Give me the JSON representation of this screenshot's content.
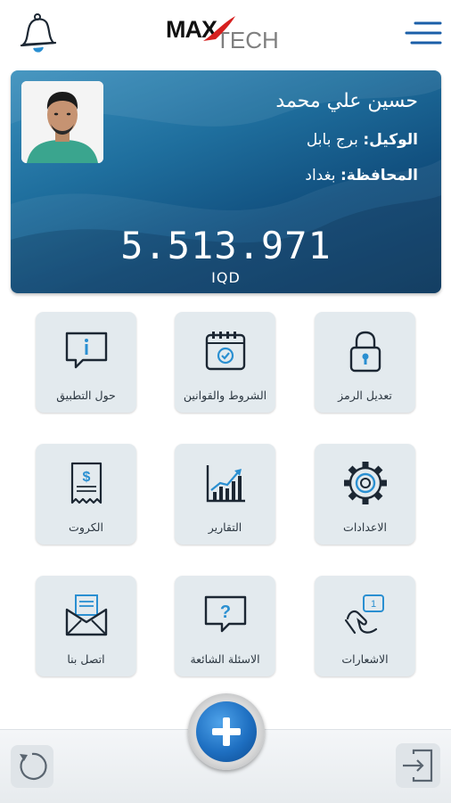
{
  "header": {
    "logo_max": "MAX",
    "logo_tech": "TECH",
    "icons": {
      "bell": "bell-icon",
      "menu": "hamburger-menu-icon"
    }
  },
  "profile": {
    "name": "حسين علي محمد",
    "agent_label": "الوكيل:",
    "agent_value": "برج بابل",
    "province_label": "المحافظة:",
    "province_value": "بغداد",
    "balance": "5.513.971",
    "currency": "IQD"
  },
  "tiles": [
    {
      "label": "تعديل الرمز",
      "icon": "lock-icon"
    },
    {
      "label": "الشروط والقوانين",
      "icon": "calendar-check-icon"
    },
    {
      "label": "حول التطبيق",
      "icon": "info-chat-icon"
    },
    {
      "label": "الاعدادات",
      "icon": "gear-icon"
    },
    {
      "label": "التقارير",
      "icon": "chart-icon"
    },
    {
      "label": "الكروت",
      "icon": "receipt-icon"
    },
    {
      "label": "الاشعارات",
      "icon": "notification-hand-icon"
    },
    {
      "label": "الاسئلة الشائعة",
      "icon": "question-chat-icon"
    },
    {
      "label": "اتصل بنا",
      "icon": "mail-icon"
    }
  ],
  "bottom": {
    "icons": {
      "refresh": "refresh-icon",
      "add": "plus-icon",
      "logout": "logout-icon"
    }
  },
  "colors": {
    "card_dark": "#0b3d66",
    "card_light": "#3a8fbd",
    "tile_bg": "#e3eaee",
    "icon_accent": "#2a8fd1",
    "fab_blue": "#1e6fc1"
  }
}
